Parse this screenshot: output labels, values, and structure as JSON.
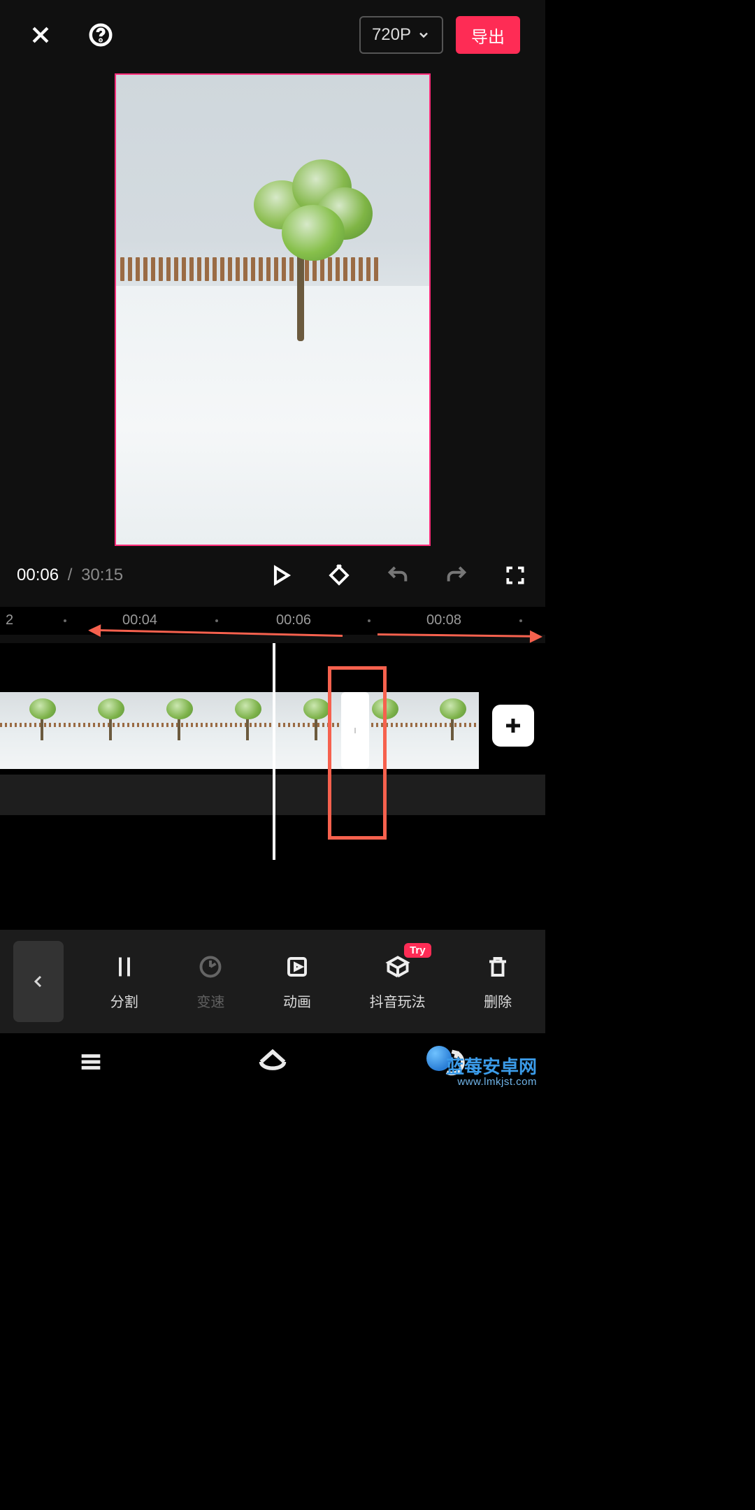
{
  "topbar": {
    "resolution_label": "720P",
    "export_label": "导出"
  },
  "playbar": {
    "current_time": "00:06",
    "separator": "/",
    "duration": "30:15"
  },
  "ruler": {
    "edge_marker": "2",
    "marks": [
      "00:04",
      "00:06",
      "00:08"
    ]
  },
  "tools": {
    "items": [
      {
        "id": "split",
        "label": "分割",
        "disabled": false,
        "badge": ""
      },
      {
        "id": "speed",
        "label": "变速",
        "disabled": true,
        "badge": ""
      },
      {
        "id": "anim",
        "label": "动画",
        "disabled": false,
        "badge": ""
      },
      {
        "id": "douyin",
        "label": "抖音玩法",
        "disabled": false,
        "badge": "Try"
      },
      {
        "id": "delete",
        "label": "删除",
        "disabled": false,
        "badge": ""
      }
    ]
  },
  "watermark": {
    "line1": "蓝莓安卓网",
    "line2": "www.lmkjst.com"
  },
  "colors": {
    "accent": "#fe2c55",
    "annot": "#f6614e"
  }
}
